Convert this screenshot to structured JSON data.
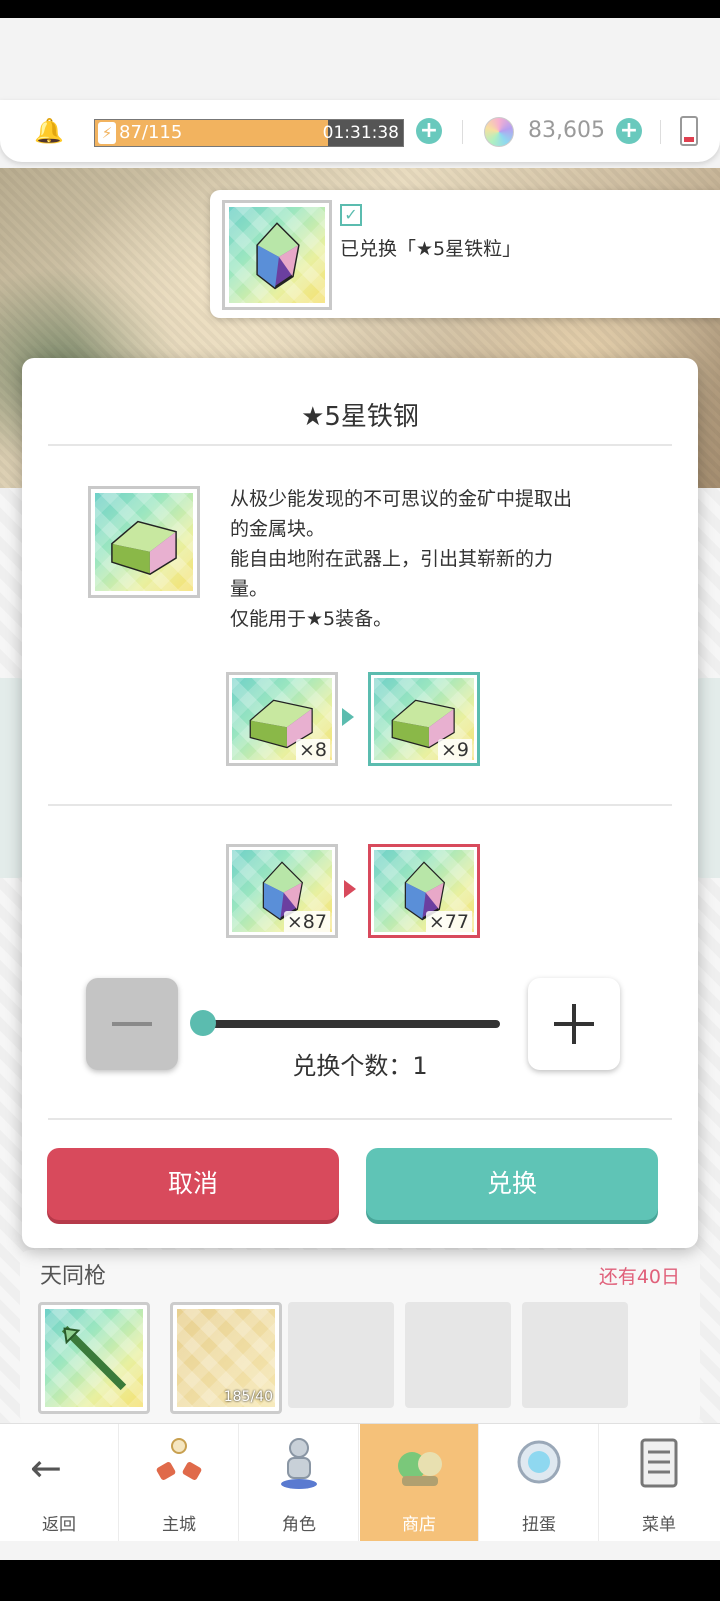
{
  "topbar": {
    "stamina": "87/115",
    "stamina_fraction": 0.757,
    "timer": "01:31:38",
    "gem_count": "83,605"
  },
  "toast": {
    "message": "已兑换「★5星铁粒」"
  },
  "modal": {
    "title": "★5星铁钢",
    "description": [
      "从极少能发现的不可思议的金矿中提取出",
      "的金属块。",
      "能自由地附在武器上，引出其崭新的力",
      "量。",
      "仅能用于★5装备。"
    ],
    "result": {
      "from_qty": "×8",
      "to_qty": "×9"
    },
    "cost": {
      "from_qty": "×87",
      "to_qty": "×77"
    },
    "exchange_count_label": "兑换个数：1",
    "exchange_count": 1,
    "cancel_label": "取消",
    "confirm_label": "兑换"
  },
  "shop": {
    "title": "天同枪",
    "remaining": "还有40日",
    "slot_count": "185/40"
  },
  "nav": {
    "items": [
      {
        "label": "返回",
        "icon": "back-arrow-icon"
      },
      {
        "label": "主城",
        "icon": "castle-icon"
      },
      {
        "label": "角色",
        "icon": "character-icon"
      },
      {
        "label": "商店",
        "icon": "shop-icon"
      },
      {
        "label": "扭蛋",
        "icon": "gacha-icon"
      },
      {
        "label": "菜单",
        "icon": "menu-icon"
      }
    ],
    "active_index": 3
  },
  "colors": {
    "teal": "#5bbcaf",
    "red": "#d84a5c",
    "stamina": "#f2b35f"
  }
}
